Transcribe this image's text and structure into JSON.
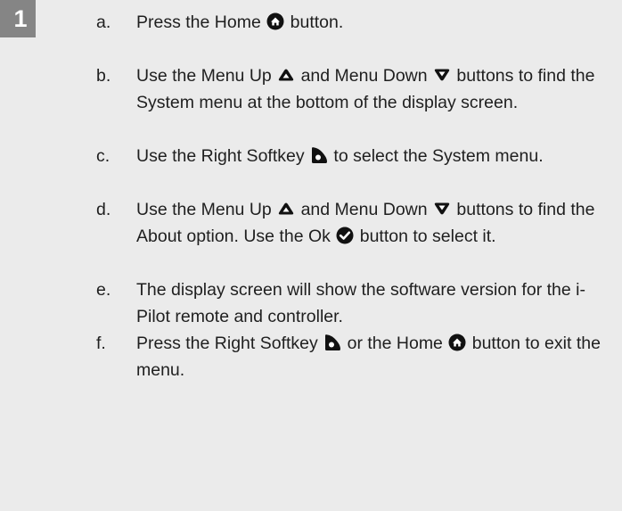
{
  "step_number": "1",
  "steps": [
    {
      "letter": "a.",
      "parts": [
        {
          "t": "Press the Home "
        },
        {
          "icon": "home"
        },
        {
          "t": " button."
        }
      ]
    },
    {
      "letter": "b.",
      "parts": [
        {
          "t": "Use the Menu Up "
        },
        {
          "icon": "menu-up"
        },
        {
          "t": " and Menu Down "
        },
        {
          "icon": "menu-down"
        },
        {
          "t": " buttons to find the System menu at the bottom of the display screen."
        }
      ]
    },
    {
      "letter": "c.",
      "parts": [
        {
          "t": "Use the Right Softkey "
        },
        {
          "icon": "right-softkey"
        },
        {
          "t": " to select the System menu."
        }
      ]
    },
    {
      "letter": "d.",
      "parts": [
        {
          "t": "Use the Menu Up "
        },
        {
          "icon": "menu-up"
        },
        {
          "t": " and Menu Down "
        },
        {
          "icon": "menu-down"
        },
        {
          "t": " buttons to find the About option. Use the Ok "
        },
        {
          "icon": "ok"
        },
        {
          "t": " button to select it."
        }
      ]
    },
    {
      "letter": "e.",
      "parts": [
        {
          "t": "The display screen will show the software version for the i-Pilot remote and controller."
        }
      ]
    },
    {
      "letter": "f.",
      "parts": [
        {
          "t": "Press the Right Softkey "
        },
        {
          "icon": "right-softkey"
        },
        {
          "t": " or the Home "
        },
        {
          "icon": "home"
        },
        {
          "t": " button to exit the menu."
        }
      ]
    }
  ]
}
